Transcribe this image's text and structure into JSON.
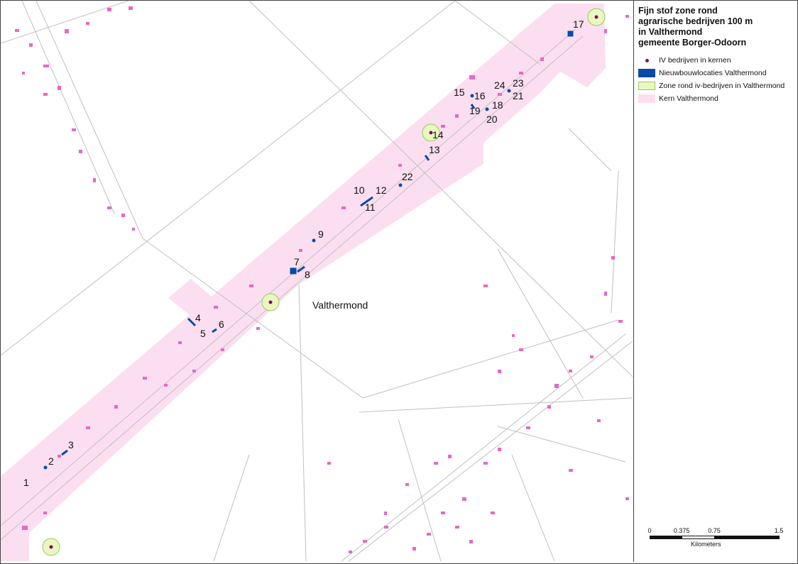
{
  "legend": {
    "title_lines": [
      "Fijn stof zone rond",
      "agrarische bedrijven 100 m",
      "in Valthermond",
      "gemeente Borger-Odoorn"
    ],
    "items": [
      {
        "label": "IV bedrijven in kernen",
        "icon": "point-symbol",
        "color": "#7a1152"
      },
      {
        "label": "Nieuwbouwlocaties Valthermond",
        "icon": "fill-symbol",
        "color": "#0a4aa8"
      },
      {
        "label": "Zone rond iv-bedrijven in Valthermond",
        "icon": "fill-symbol",
        "color": "#e9f7c2"
      },
      {
        "label": "Kern Valthermond",
        "icon": "fill-symbol",
        "color": "#fbdff0"
      }
    ]
  },
  "scale": {
    "ticks": [
      "0",
      "0.375",
      "0.75",
      "1.5"
    ],
    "unit": "Kilometers"
  },
  "map": {
    "place_label": "Valthermond",
    "location_numbers": [
      "1",
      "2",
      "3",
      "4",
      "5",
      "6",
      "7",
      "8",
      "9",
      "10",
      "11",
      "12",
      "13",
      "14",
      "15",
      "16",
      "17",
      "18",
      "19",
      "20",
      "21",
      "22",
      "23",
      "24"
    ]
  }
}
